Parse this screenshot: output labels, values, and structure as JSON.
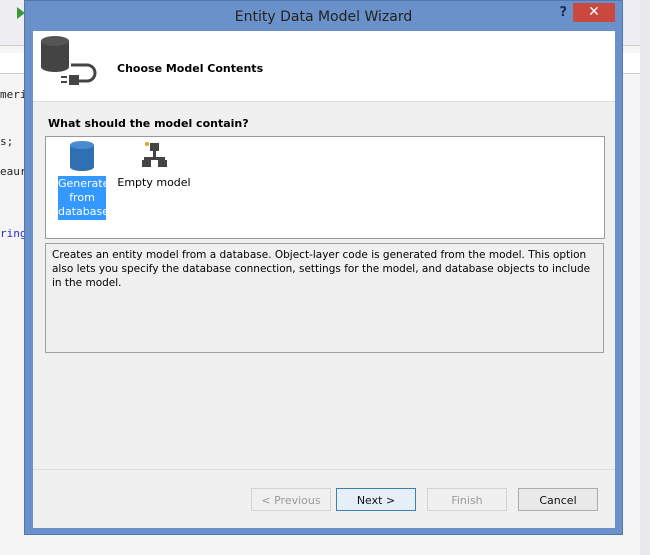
{
  "background": {
    "code_lines": [
      "meri",
      "s;",
      "eaur",
      "ring"
    ]
  },
  "dialog": {
    "title": "Entity Data Model Wizard",
    "help_label": "?",
    "close_label": "✕",
    "header_title": "Choose Model Contents",
    "question": "What should the model contain?",
    "options": [
      {
        "label": "Generate from database",
        "selected": true
      },
      {
        "label": "Empty model",
        "selected": false
      }
    ],
    "description": "Creates an entity model from a database. Object-layer code is generated from the model. This option also lets you specify the database connection, settings for the model, and database objects to include in the model.",
    "buttons": {
      "previous": "< Previous",
      "next": "Next >",
      "finish": "Finish",
      "cancel": "Cancel"
    }
  }
}
